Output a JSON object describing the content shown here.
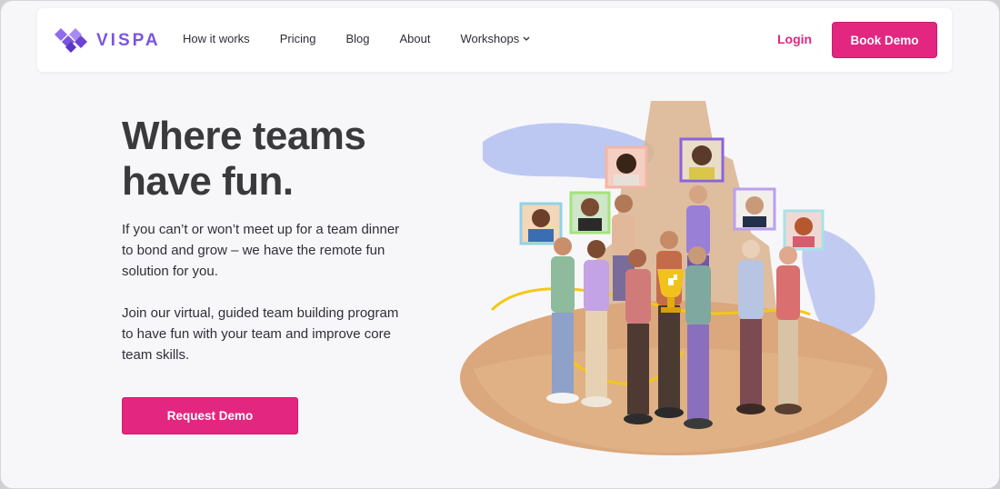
{
  "brand": {
    "name": "VISPA",
    "accent": "#7a55e0",
    "cta_color": "#e3267f"
  },
  "nav": {
    "links": [
      "How it works",
      "Pricing",
      "Blog",
      "About",
      "Workshops"
    ],
    "login_label": "Login",
    "book_demo_label": "Book Demo"
  },
  "hero": {
    "headline_line1": "Where teams",
    "headline_line2": "have fun.",
    "paragraph1": "If you can’t or won’t meet up for a team dinner to bond and grow – we have the remote fun solution for you.",
    "paragraph2": "Join our virtual, guided team building program to have fun with your team and improve core team skills.",
    "cta_label": "Request Demo"
  }
}
